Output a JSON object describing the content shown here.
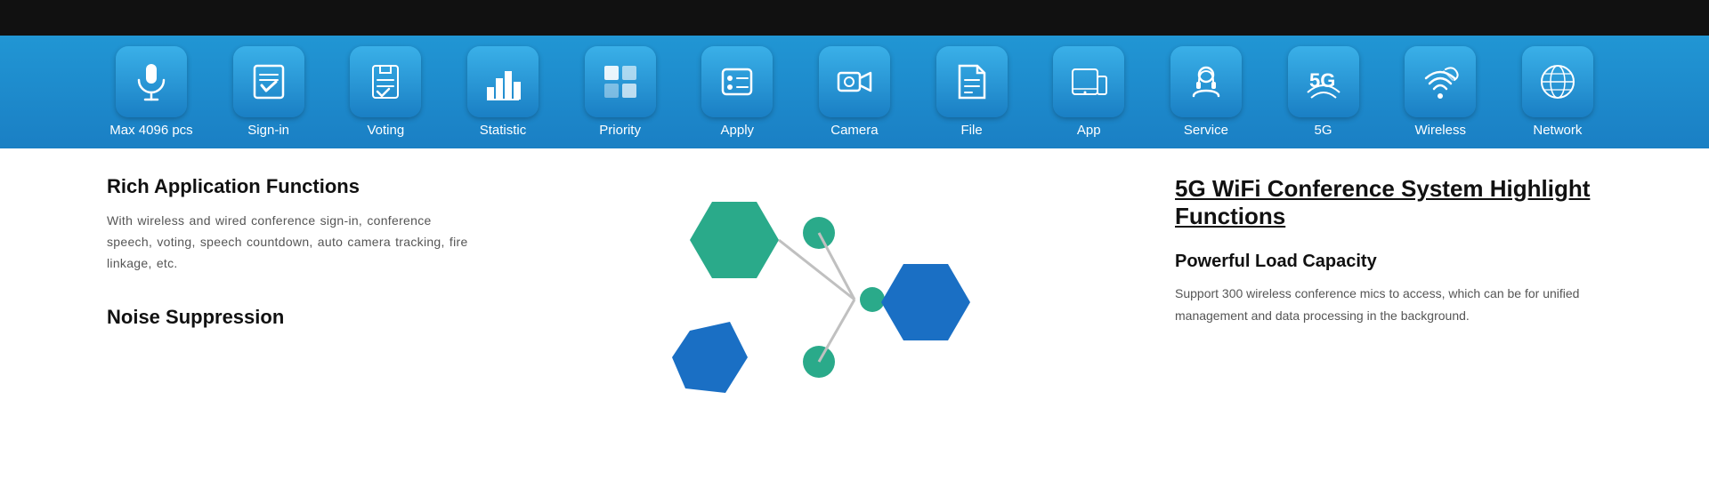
{
  "topBar": {
    "height": 40
  },
  "iconBar": {
    "items": [
      {
        "id": "max4096",
        "label": "Max 4096 pcs",
        "icon": "microphone"
      },
      {
        "id": "signin",
        "label": "Sign-in",
        "icon": "signin"
      },
      {
        "id": "voting",
        "label": "Voting",
        "icon": "voting"
      },
      {
        "id": "statistic",
        "label": "Statistic",
        "icon": "statistic"
      },
      {
        "id": "priority",
        "label": "Priority",
        "icon": "priority"
      },
      {
        "id": "apply",
        "label": "Apply",
        "icon": "apply"
      },
      {
        "id": "camera",
        "label": "Camera",
        "icon": "camera"
      },
      {
        "id": "file",
        "label": "File",
        "icon": "file"
      },
      {
        "id": "app",
        "label": "App",
        "icon": "app"
      },
      {
        "id": "service",
        "label": "Service",
        "icon": "service"
      },
      {
        "id": "fiveg",
        "label": "5G",
        "icon": "fiveg"
      },
      {
        "id": "wireless",
        "label": "Wireless",
        "icon": "wireless"
      },
      {
        "id": "network",
        "label": "Network",
        "icon": "network"
      }
    ]
  },
  "content": {
    "leftTitle1": "Rich Application Functions",
    "leftText1": "With wireless and wired conference sign-in, conference speech, voting, speech countdown, auto camera tracking, fire linkage, etc.",
    "leftTitle2": "Noise Suppression",
    "middleDiagram": "hexagon-diagram",
    "rightMainTitle": "5G WiFi Conference System  Highlight Functions",
    "rightSubTitle": "Powerful Load Capacity",
    "rightText": "Support 300 wireless conference mics to access, which can be  for unified management and data processing in the background."
  }
}
